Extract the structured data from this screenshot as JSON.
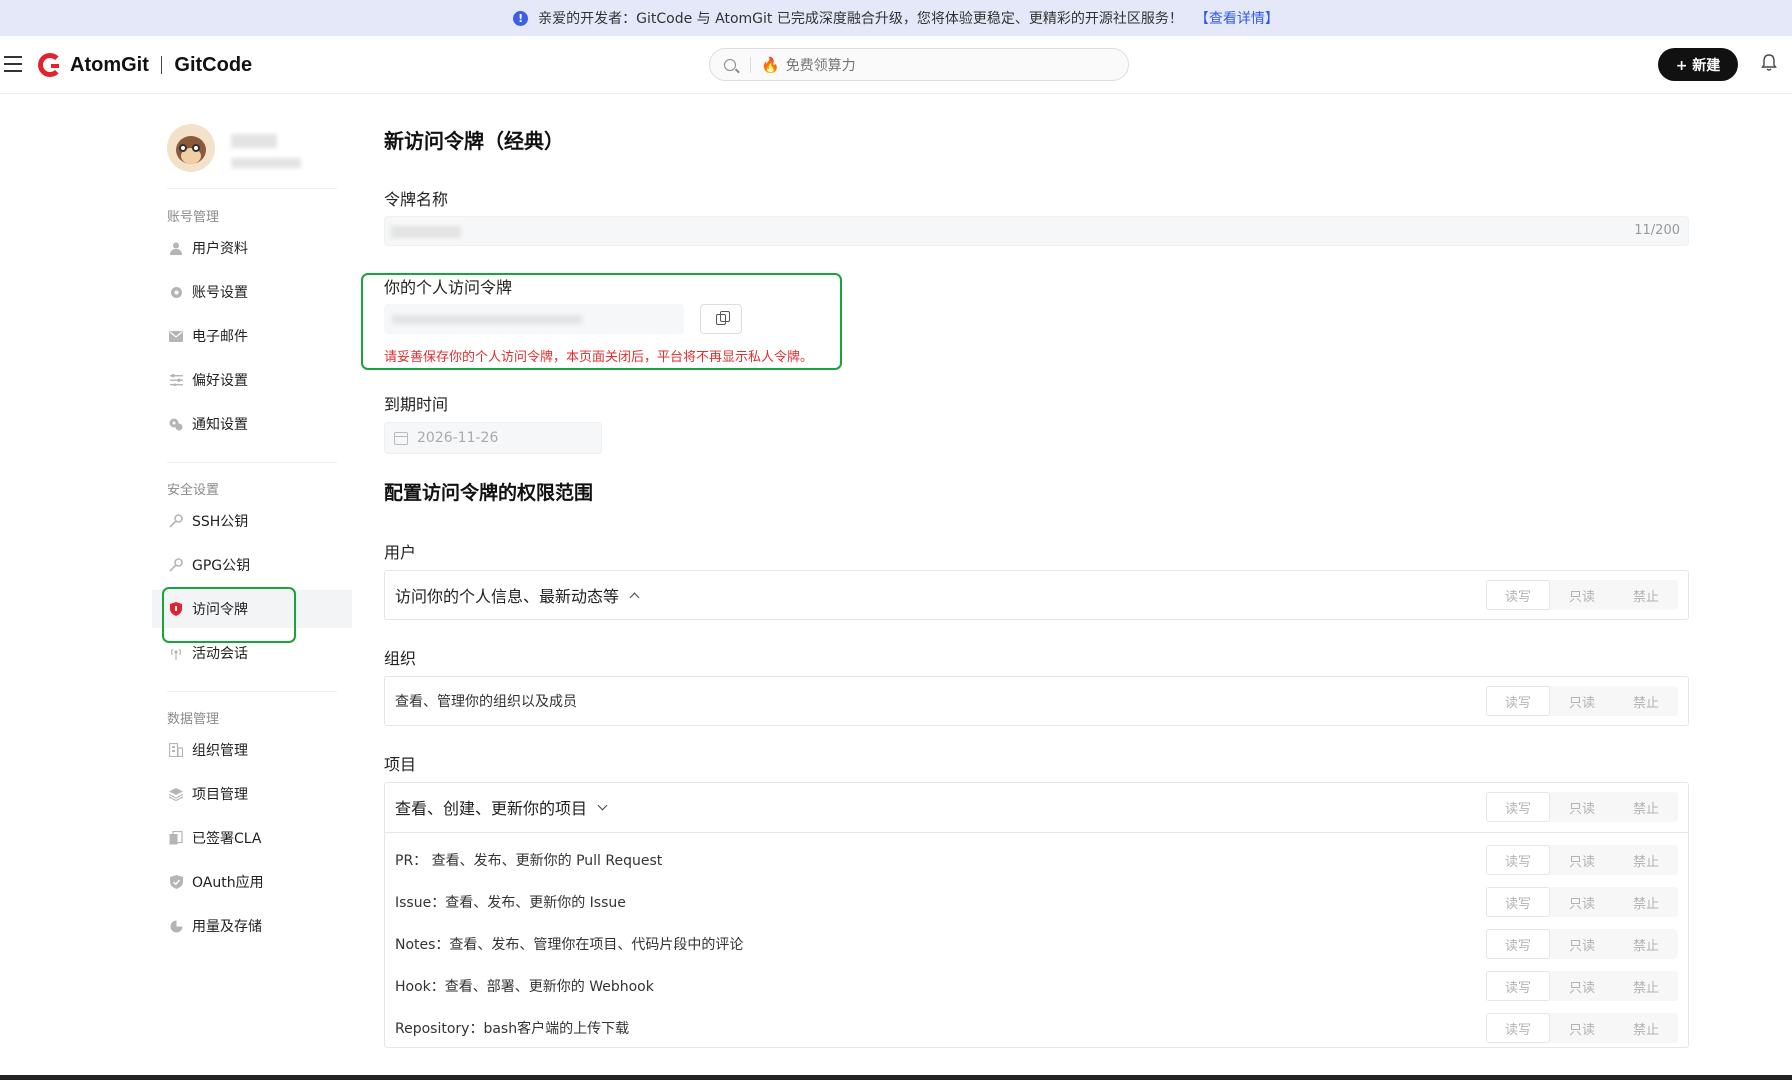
{
  "banner": {
    "text": "亲爱的开发者：GitCode 与 AtomGit 已完成深度融合升级，您将体验更稳定、更精彩的开源社区服务！",
    "link": "【查看详情】"
  },
  "header": {
    "logo_left": "AtomGit",
    "logo_right": "GitCode",
    "search_placeholder": "免费领算力",
    "new_button": "+ 新建"
  },
  "sidebar": {
    "groups": [
      {
        "title": "账号管理",
        "items": [
          "用户资料",
          "账号设置",
          "电子邮件",
          "偏好设置",
          "通知设置"
        ]
      },
      {
        "title": "安全设置",
        "items": [
          "SSH公钥",
          "GPG公钥",
          "访问令牌",
          "活动会话"
        ]
      },
      {
        "title": "数据管理",
        "items": [
          "组织管理",
          "项目管理",
          "已签署CLA",
          "OAuth应用",
          "用量及存储"
        ]
      }
    ],
    "active_item": "访问令牌"
  },
  "main": {
    "title": "新访问令牌（经典）",
    "token_name_label": "令牌名称",
    "token_name_count": "11/200",
    "personal_token_label": "你的个人访问令牌",
    "warning": "请妥善保存你的个人访问令牌，本页面关闭后，平台将不再显示私人令牌。",
    "expiry_label": "到期时间",
    "expiry_value": "2026-11-26",
    "scope_title": "配置访问令牌的权限范围",
    "options": [
      "读写",
      "只读",
      "禁止"
    ],
    "groups": {
      "user": {
        "label": "用户",
        "head": "访问你的个人信息、最新动态等"
      },
      "org": {
        "label": "组织",
        "head": "查看、管理你的组织以及成员"
      },
      "project": {
        "label": "项目",
        "head": "查看、创建、更新你的项目",
        "rows": [
          "PR： 查看、发布、更新你的 Pull Request",
          "Issue：查看、发布、更新你的 Issue",
          "Notes：查看、发布、管理你在项目、代码片段中的评论",
          "Hook：查看、部署、更新你的 Webhook",
          "Repository：bash客户端的上传下载"
        ]
      }
    }
  }
}
